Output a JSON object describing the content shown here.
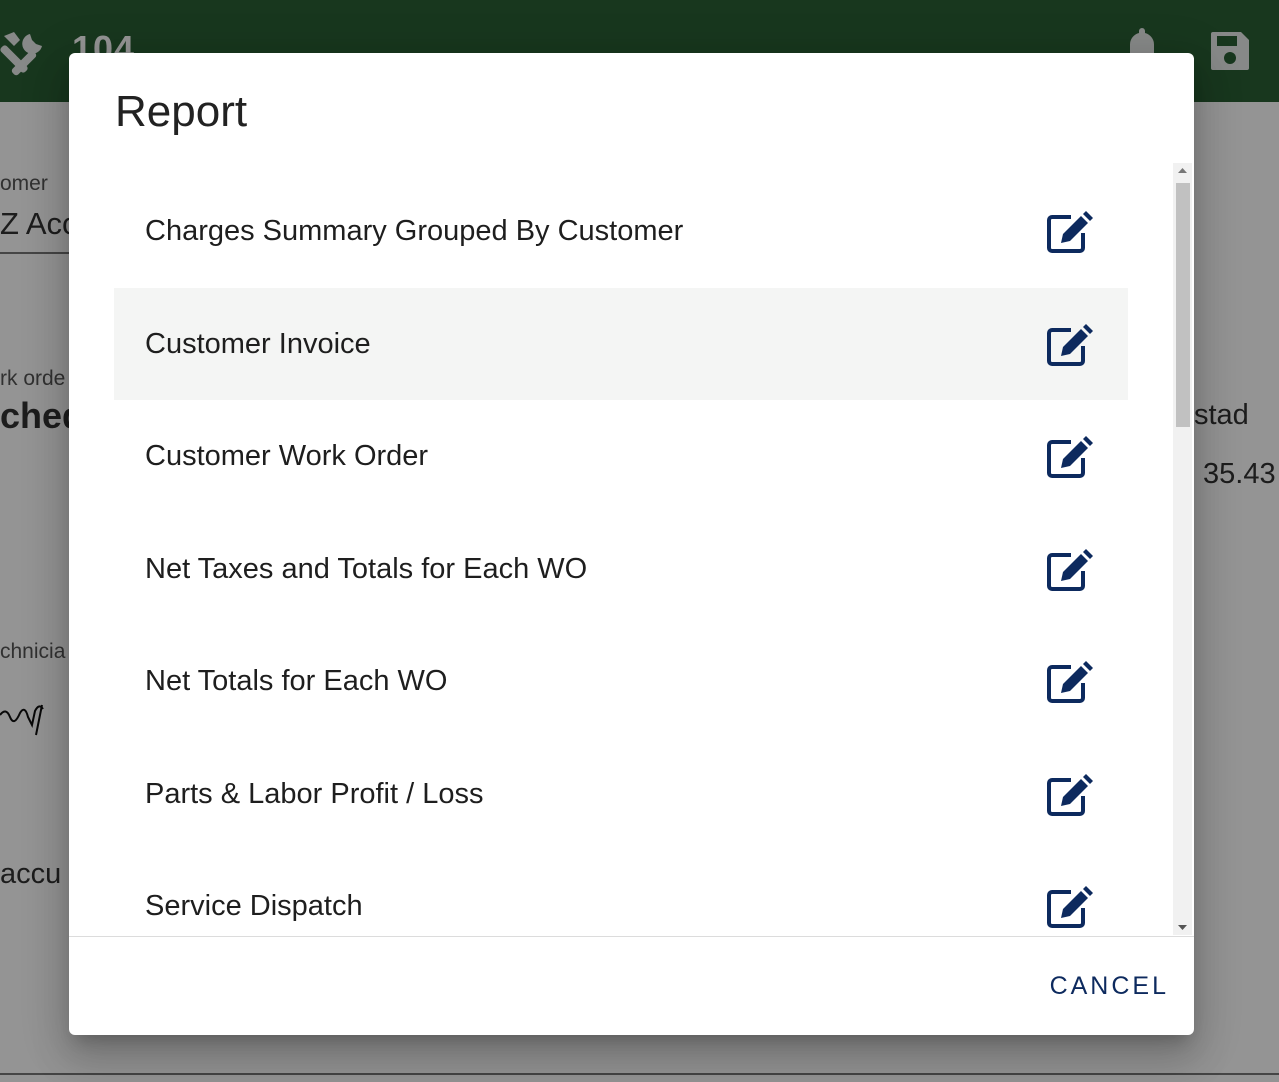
{
  "appbar": {
    "wo_number": "104",
    "tools_icon": "tools-icon",
    "bell_icon": "bell-icon",
    "save_icon": "save-icon"
  },
  "background": {
    "customer_label": "omer",
    "customer_value": "Z Acc",
    "work_order_label": "rk orde",
    "status_value": "ched",
    "location_value": "stad",
    "amount_value": "35.43",
    "technician_label": "chnicia",
    "accuracy_text": "accu"
  },
  "dialog": {
    "title": "Report",
    "items": [
      {
        "label": "Charges Summary Grouped By Customer",
        "icon": "edit-icon"
      },
      {
        "label": "Customer Invoice",
        "icon": "edit-icon"
      },
      {
        "label": "Customer Work Order",
        "icon": "edit-icon"
      },
      {
        "label": "Net Taxes and Totals for Each WO",
        "icon": "edit-icon"
      },
      {
        "label": "Net Totals for Each WO",
        "icon": "edit-icon"
      },
      {
        "label": "Parts & Labor Profit / Loss",
        "icon": "edit-icon"
      },
      {
        "label": "Service Dispatch",
        "icon": "edit-icon"
      }
    ],
    "cancel_label": "CANCEL"
  },
  "colors": {
    "appbar": "#2a5f34",
    "accent": "#0d2a5e",
    "hover_row": "#f4f5f4"
  }
}
